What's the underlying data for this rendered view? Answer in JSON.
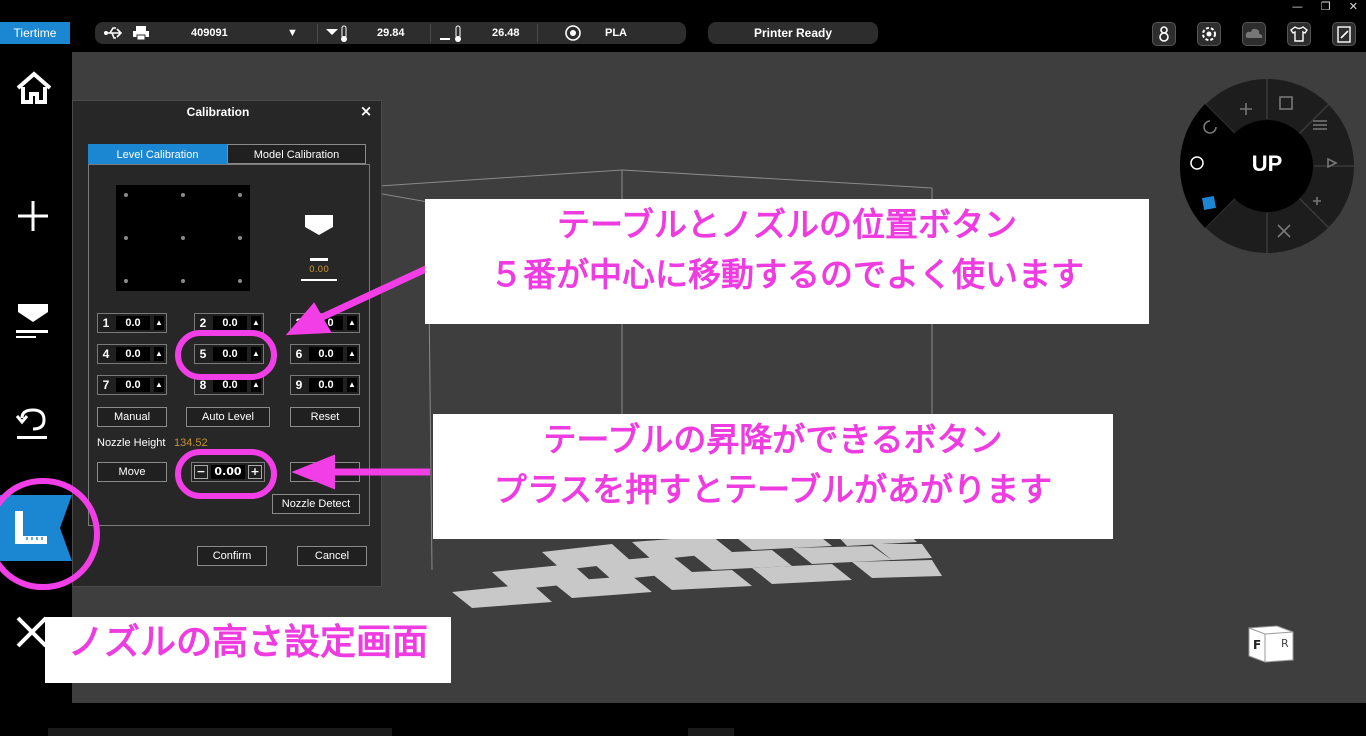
{
  "window": {
    "brand": "Tiertime",
    "controls": [
      "—",
      "❐",
      "✕"
    ]
  },
  "status": {
    "printer_id": "409091",
    "nozzle_temp": "29.84",
    "bed_temp": "26.48",
    "material": "PLA",
    "printer_state": "Printer Ready"
  },
  "dialog": {
    "title": "Calibration",
    "close": "×",
    "tabs": [
      "Level Calibration",
      "Model Calibration"
    ],
    "nozzle_readout": "0.00",
    "spots": [
      {
        "num": "1",
        "val": "0.0"
      },
      {
        "num": "2",
        "val": "0.0"
      },
      {
        "num": "3",
        "val": "0.0"
      },
      {
        "num": "4",
        "val": "0.0"
      },
      {
        "num": "5",
        "val": "0.0"
      },
      {
        "num": "6",
        "val": "0.0"
      },
      {
        "num": "7",
        "val": "0.0"
      },
      {
        "num": "8",
        "val": "0.0"
      },
      {
        "num": "9",
        "val": "0.0"
      }
    ],
    "manual_label": "Manual",
    "auto_level_label": "Auto Level",
    "reset_label": "Reset",
    "nozzle_height_label": "Nozzle Height",
    "nozzle_height_value": "134.52",
    "move_label": "Move",
    "minus_label": "−",
    "step_value": "0.00",
    "plus_label": "+",
    "nozzle_detect_label": "Nozzle Detect",
    "confirm_label": "Confirm",
    "cancel_label": "Cancel"
  },
  "wheel": {
    "logo": "UP"
  },
  "viewcube": {
    "front": "F",
    "right": "R"
  },
  "annotations": {
    "note1_line1": "テーブルとノズルの位置ボタン",
    "note1_line2": "５番が中心に移動するのでよく使います",
    "note2_line1": "テーブルの昇降ができるボタン",
    "note2_line2": "プラスを押すとテーブルがあがります",
    "note3": "ノズルの高さ設定画面"
  },
  "colors": {
    "accent": "#1b87d3",
    "annotation": "#ee3ce0",
    "warn": "#c8922a"
  }
}
